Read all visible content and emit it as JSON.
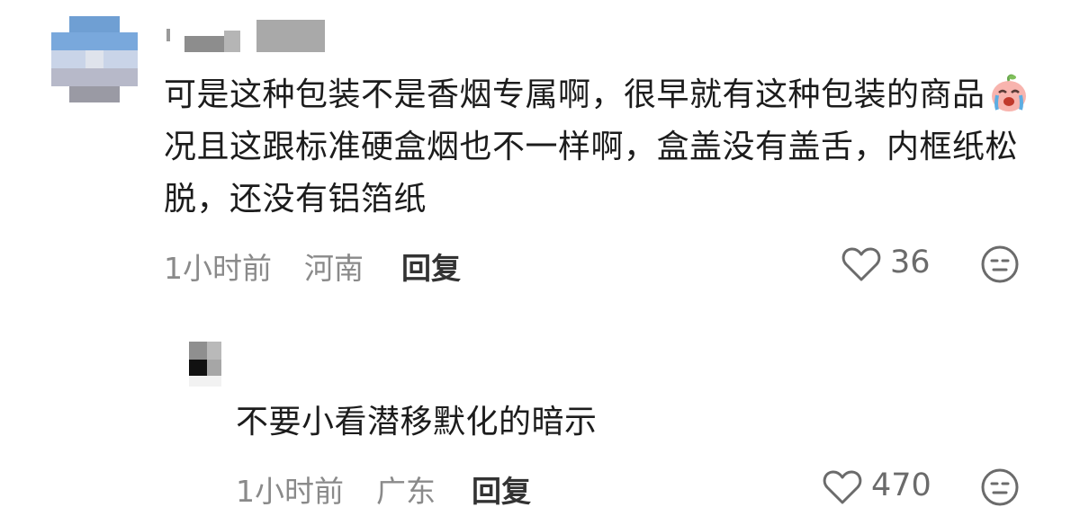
{
  "comments": [
    {
      "text_before_emoji": "可是这种包装不是香烟专属啊，很早就有这种包装的商品",
      "text_after_emoji": "况且这跟标准硬盒烟也不一样啊，盒盖没有盖舌，内框纸松脱，还没有铝箔纸",
      "emoji": "crying-peach-emoji",
      "time": "1小时前",
      "location": "河南",
      "reply_label": "回复",
      "likes": "36"
    },
    {
      "text": "不要小看潜移默化的暗示",
      "time": "1小时前",
      "location": "广东",
      "reply_label": "回复",
      "likes": "470"
    }
  ],
  "icons": {
    "like": "heart-outline-icon",
    "dislike": "meh-face-icon"
  },
  "colors": {
    "text": "#1c1c1c",
    "meta": "#8a8a8a",
    "icon": "#6b6b6b"
  }
}
